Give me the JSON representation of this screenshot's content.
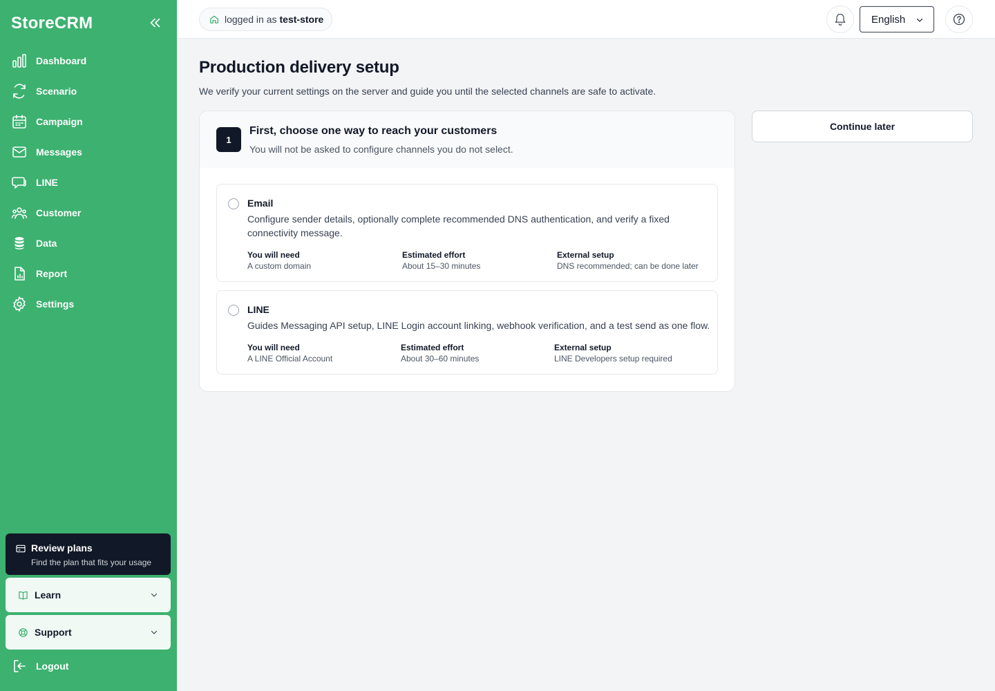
{
  "app": {
    "brand": "StoreCRM"
  },
  "sidebar": {
    "items": [
      {
        "label": "Dashboard",
        "icon": "bar-chart-icon"
      },
      {
        "label": "Scenario",
        "icon": "refresh-icon"
      },
      {
        "label": "Campaign",
        "icon": "calendar-icon"
      },
      {
        "label": "Messages",
        "icon": "mail-icon"
      },
      {
        "label": "LINE",
        "icon": "chat-icon"
      },
      {
        "label": "Customer",
        "icon": "users-icon"
      },
      {
        "label": "Data",
        "icon": "database-icon"
      },
      {
        "label": "Report",
        "icon": "report-icon"
      },
      {
        "label": "Settings",
        "icon": "gear-icon"
      }
    ],
    "plan": {
      "title": "Review plans",
      "subtitle": "Find the plan that fits your usage"
    },
    "learn": {
      "label": "Learn"
    },
    "support": {
      "label": "Support"
    },
    "logout": {
      "label": "Logout"
    }
  },
  "header": {
    "login_prefix": "logged in as",
    "username": "test-store",
    "language": "English"
  },
  "main": {
    "title": "Production delivery setup",
    "description": "We verify your current settings on the server and guide you until the selected channels are safe to activate.",
    "continue_label": "Continue later",
    "step": {
      "number": "1",
      "title": "First, choose one way to reach your customers",
      "subtitle": "You will not be asked to configure channels you do not select."
    },
    "options": [
      {
        "title": "Email",
        "description": "Configure sender details, optionally complete recommended DNS authentication, and verify a fixed connectivity message.",
        "meta": [
          {
            "key": "You will need",
            "value": "A custom domain"
          },
          {
            "key": "Estimated effort",
            "value": "About 15–30 minutes"
          },
          {
            "key": "External setup",
            "value": "DNS recommended; can be done later"
          }
        ]
      },
      {
        "title": "LINE",
        "description": "Guides Messaging API setup, LINE Login account linking, webhook verification, and a test send as one flow.",
        "meta": [
          {
            "key": "You will need",
            "value": "A LINE Official Account"
          },
          {
            "key": "Estimated effort",
            "value": "About 30–60 minutes"
          },
          {
            "key": "External setup",
            "value": "LINE Developers setup required"
          }
        ]
      }
    ]
  },
  "colors": {
    "sidebar": "#3db170",
    "dark": "#111827",
    "accent_soft": "#f0f9f4"
  }
}
